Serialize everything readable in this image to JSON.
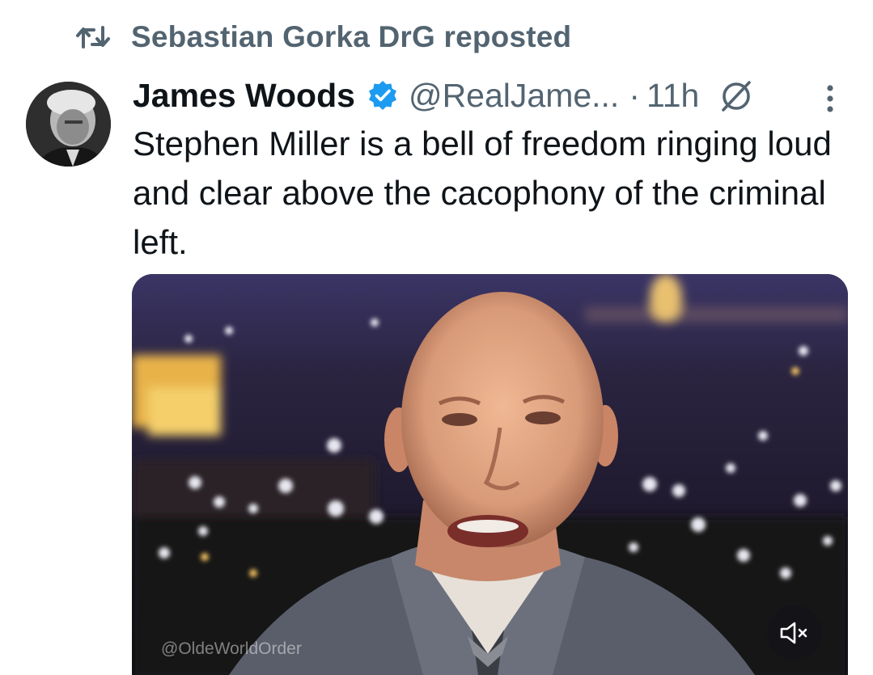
{
  "repost": {
    "text": "Sebastian Gorka DrG reposted",
    "icon": "repost-icon"
  },
  "tweet": {
    "author_name": "James Woods",
    "verified": true,
    "handle": "@RealJame...",
    "separator": "·",
    "time": "11h",
    "text": "Stephen Miller is a bell of freedom ringing loud and clear above the cacophony of the criminal left."
  },
  "media": {
    "type": "video",
    "watermark": "@OldeWorldOrder",
    "muted": true
  },
  "colors": {
    "text": "#0f1419",
    "secondary": "#536471",
    "verified_badge": "#1d9bf0"
  }
}
